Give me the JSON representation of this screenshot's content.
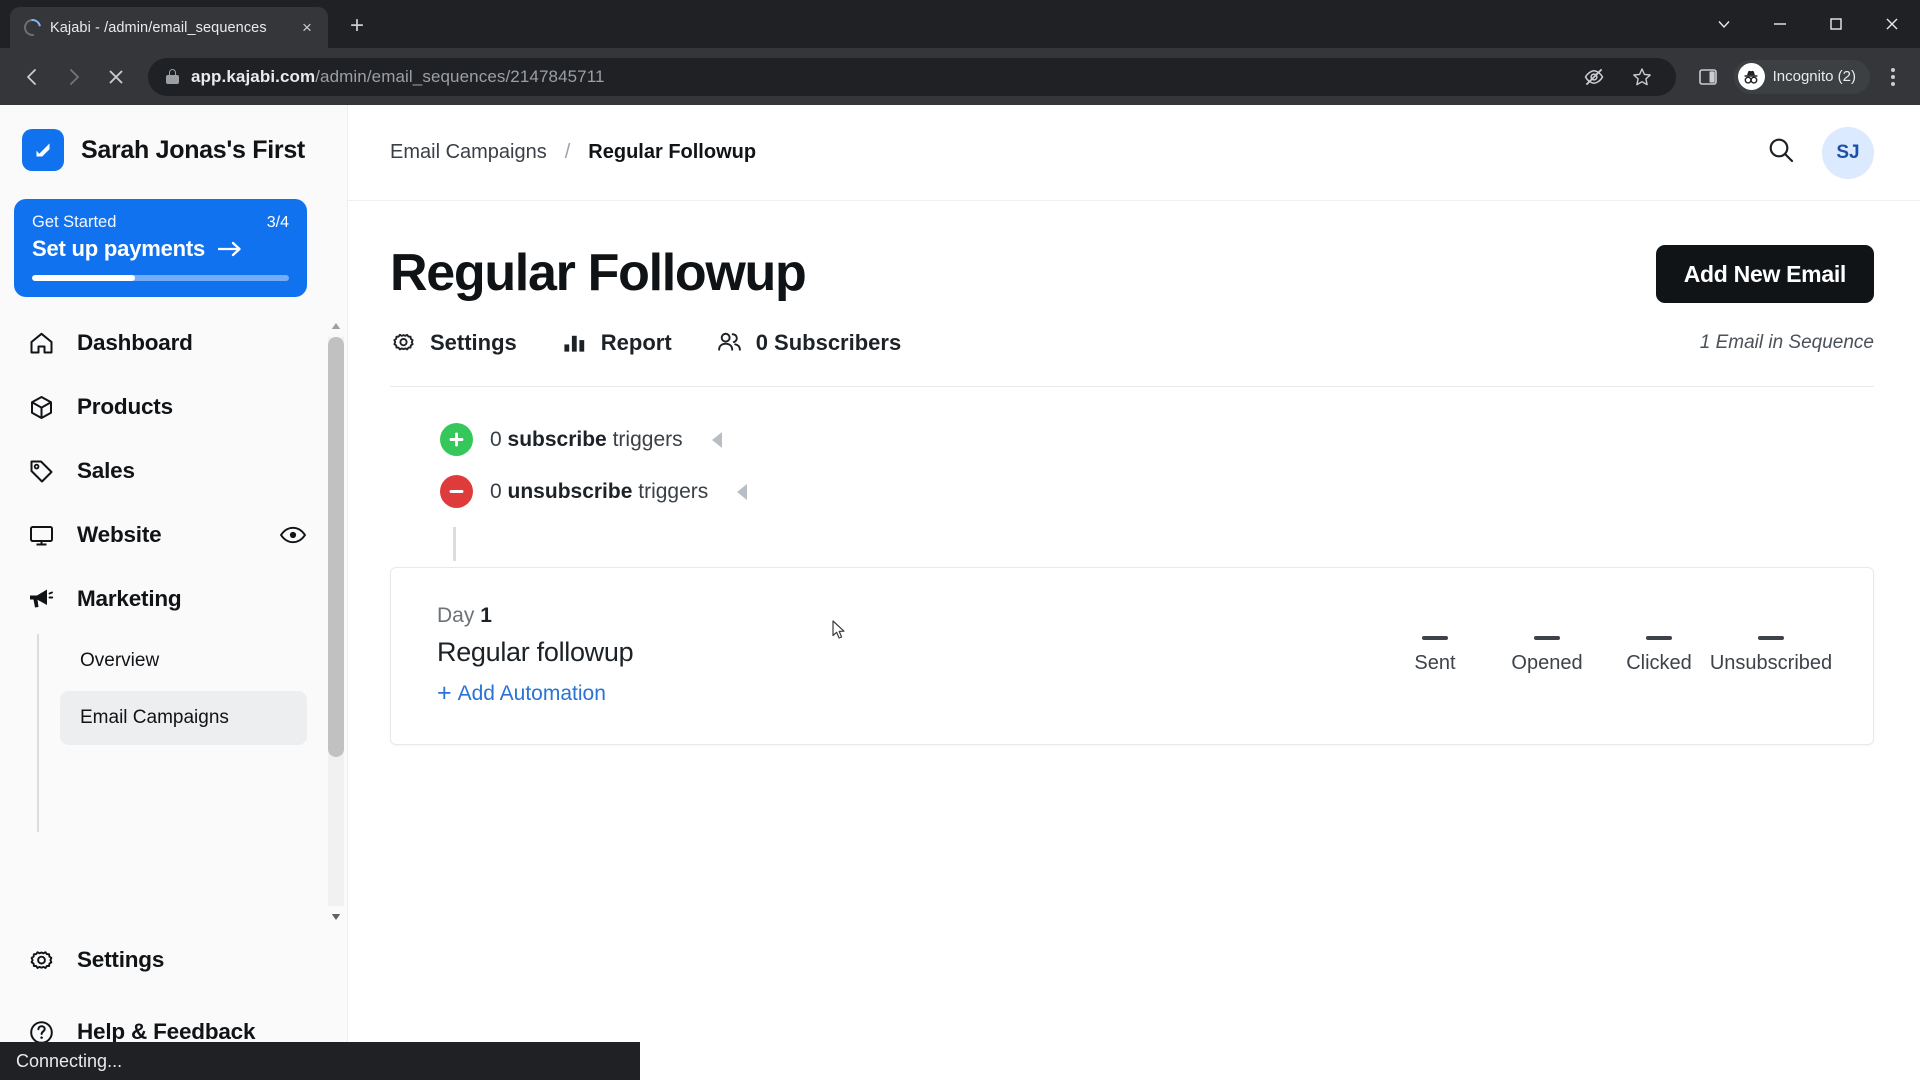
{
  "browser": {
    "tab": {
      "title": "Kajabi - /admin/email_sequences",
      "close_label": "×",
      "spinner_icon": "loading-spinner-icon"
    },
    "new_tab_label": "+",
    "window_controls": {
      "minimize": "—",
      "maximize": "❐",
      "close": "✕",
      "chevron": "⌄"
    },
    "nav": {
      "back": "←",
      "forward": "→",
      "stop": "✕"
    },
    "url_host": "app.kajabi.com",
    "url_path": "/admin/email_sequences/2147845711",
    "full_url": "app.kajabi.com/admin/email_sequences/2147845711",
    "profile_label": "Incognito (2)",
    "icons": {
      "lock": "lock-icon",
      "eye_off": "eye-off-icon",
      "star": "bookmark-star-icon",
      "side_panel": "side-panel-icon",
      "menu": "three-dot-menu-icon"
    }
  },
  "status_bar": {
    "text": "Connecting..."
  },
  "sidebar": {
    "brand": {
      "name": "Sarah Jonas's First",
      "logo_icon": "kajabi-logo-icon"
    },
    "get_started": {
      "label": "Get Started",
      "count": "3/4",
      "action": "Set up payments",
      "arrow": "→",
      "progress_percent": 40
    },
    "items": [
      {
        "label": "Dashboard",
        "icon": "home-icon"
      },
      {
        "label": "Products",
        "icon": "box-icon"
      },
      {
        "label": "Sales",
        "icon": "tag-icon"
      },
      {
        "label": "Website",
        "icon": "monitor-icon",
        "trailing_icon": "eye-icon"
      },
      {
        "label": "Marketing",
        "icon": "megaphone-icon"
      }
    ],
    "subitems": [
      {
        "label": "Overview",
        "active": false
      },
      {
        "label": "Email Campaigns",
        "active": true
      }
    ],
    "bottom_items": [
      {
        "label": "Settings",
        "icon": "gear-icon"
      },
      {
        "label": "Help & Feedback",
        "icon": "help-circle-icon"
      }
    ]
  },
  "header": {
    "breadcrumb_parent": "Email Campaigns",
    "breadcrumb_sep": "/",
    "breadcrumb_current": "Regular Followup",
    "search_icon": "search-icon",
    "avatar_initials": "SJ"
  },
  "main": {
    "title": "Regular Followup",
    "primary_button": "Add New Email",
    "tabs": [
      {
        "label": "Settings",
        "icon": "gear-icon"
      },
      {
        "label": "Report",
        "icon": "bar-chart-icon"
      },
      {
        "label": "0 Subscribers",
        "icon": "people-icon"
      }
    ],
    "sequence_note": "1 Email in Sequence",
    "triggers": [
      {
        "count": "0",
        "type": "subscribe",
        "suffix": "triggers",
        "badge": "plus-circle-icon",
        "kind": "add"
      },
      {
        "count": "0",
        "type": "unsubscribe",
        "suffix": "triggers",
        "badge": "minus-circle-icon",
        "kind": "rem"
      }
    ],
    "email_card": {
      "day_prefix": "Day",
      "day_number": "1",
      "name": "Regular followup",
      "add_automation": "Add Automation",
      "stats": [
        {
          "value": "—",
          "label": "Sent"
        },
        {
          "value": "—",
          "label": "Opened"
        },
        {
          "value": "—",
          "label": "Clicked"
        },
        {
          "value": "—",
          "label": "Unsubscribed"
        }
      ]
    }
  },
  "colors": {
    "brand_blue": "#1172f0",
    "link_blue": "#2a72d4",
    "success_green": "#35c75a",
    "danger_red": "#e03b3b",
    "dark": "#111417"
  }
}
